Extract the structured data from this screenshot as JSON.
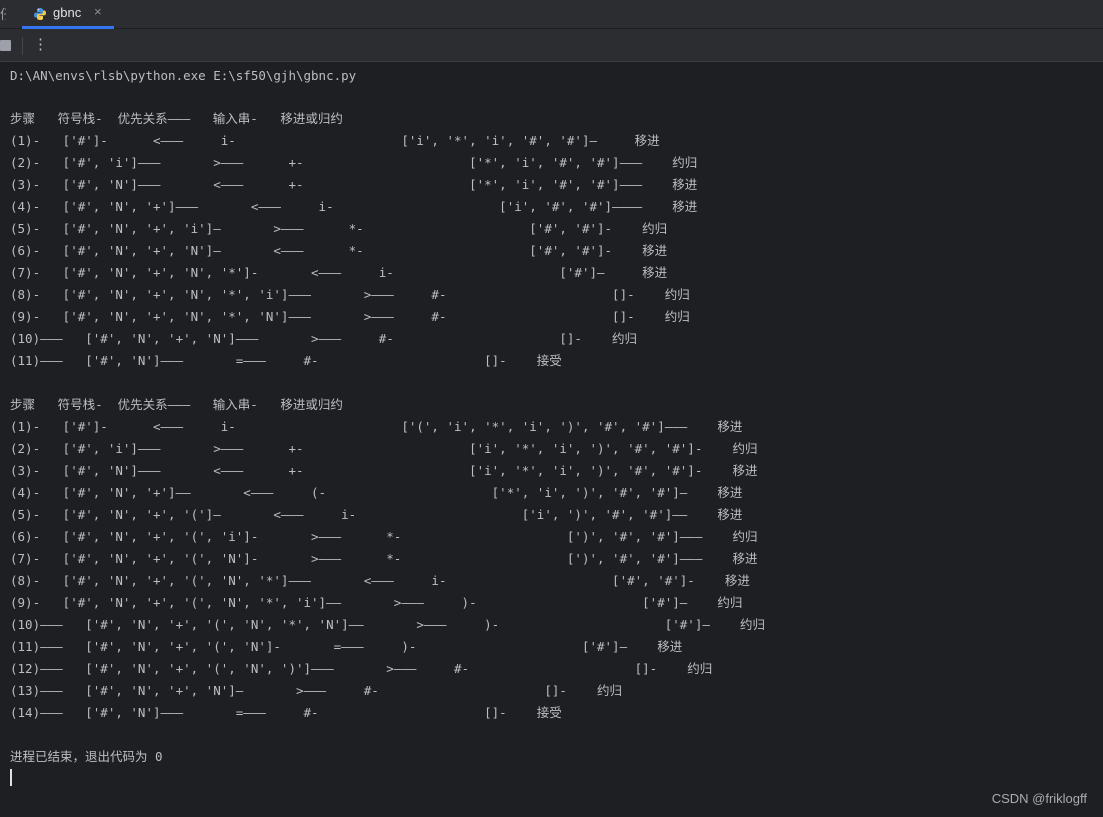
{
  "tabs": [
    {
      "label": "gbnc",
      "close": "×"
    }
  ],
  "console": {
    "command": "D:\\AN\\envs\\rlsb\\python.exe E:\\sf50\\gjh\\gbnc.py",
    "lines1": [
      "步骤   符号栈-  优先关系———   输入串-   移进或归约",
      "(1)-   ['#']-      <———     i-                      ['i', '*', 'i', '#', '#']—     移进",
      "(2)-   ['#', 'i']———       >———      +-                      ['*', 'i', '#', '#']———    约归",
      "(3)-   ['#', 'N']———       <———      +-                      ['*', 'i', '#', '#']———    移进",
      "(4)-   ['#', 'N', '+']———       <———     i-                      ['i', '#', '#']————    移进",
      "(5)-   ['#', 'N', '+', 'i']—       >———      *-                      ['#', '#']-    约归",
      "(6)-   ['#', 'N', '+', 'N']—       <———      *-                      ['#', '#']-    移进",
      "(7)-   ['#', 'N', '+', 'N', '*']-       <———     i-                      ['#']—     移进",
      "(8)-   ['#', 'N', '+', 'N', '*', 'i']———       >———     #-                      []-    约归",
      "(9)-   ['#', 'N', '+', 'N', '*', 'N']———       >———     #-                      []-    约归",
      "(10)———   ['#', 'N', '+', 'N']———       >———     #-                      []-    约归",
      "(11)———   ['#', 'N']———       =———     #-                      []-    接受"
    ],
    "lines2": [
      "步骤   符号栈-  优先关系———   输入串-   移进或归约",
      "(1)-   ['#']-      <———     i-                      ['(', 'i', '*', 'i', ')', '#', '#']———    移进",
      "(2)-   ['#', 'i']———       >———      +-                      ['i', '*', 'i', ')', '#', '#']-    约归",
      "(3)-   ['#', 'N']———       <———      +-                      ['i', '*', 'i', ')', '#', '#']-    移进",
      "(4)-   ['#', 'N', '+']——       <———     (-                      ['*', 'i', ')', '#', '#']—    移进",
      "(5)-   ['#', 'N', '+', '(']—       <———     i-                      ['i', ')', '#', '#']——    移进",
      "(6)-   ['#', 'N', '+', '(', 'i']-       >———      *-                      [')', '#', '#']———    约归",
      "(7)-   ['#', 'N', '+', '(', 'N']-       >———      *-                      [')', '#', '#']———    移进",
      "(8)-   ['#', 'N', '+', '(', 'N', '*']———       <———     i-                      ['#', '#']-    移进",
      "(9)-   ['#', 'N', '+', '(', 'N', '*', 'i']——       >———     )-                      ['#']—    约归",
      "(10)———   ['#', 'N', '+', '(', 'N', '*', 'N']——       >———     )-                      ['#']—    约归",
      "(11)———   ['#', 'N', '+', '(', 'N']-       =———     )-                      ['#']—    移进",
      "(12)———   ['#', 'N', '+', '(', 'N', ')']———       >———     #-                      []-    约归",
      "(13)———   ['#', 'N', '+', 'N']—       >———     #-                      []-    约归",
      "(14)———   ['#', 'N']———       =———     #-                      []-    接受"
    ],
    "exit_message": "进程已结束，退出代码为 0"
  },
  "watermark": "CSDN @friklogff",
  "icons": {
    "tab": "python-file-icon",
    "stop": "stop-icon",
    "more": "more-vertical-icon"
  },
  "colors": {
    "background": "#1e1f22",
    "tab_underline": "#3574f0",
    "text": "#bcbec4"
  }
}
